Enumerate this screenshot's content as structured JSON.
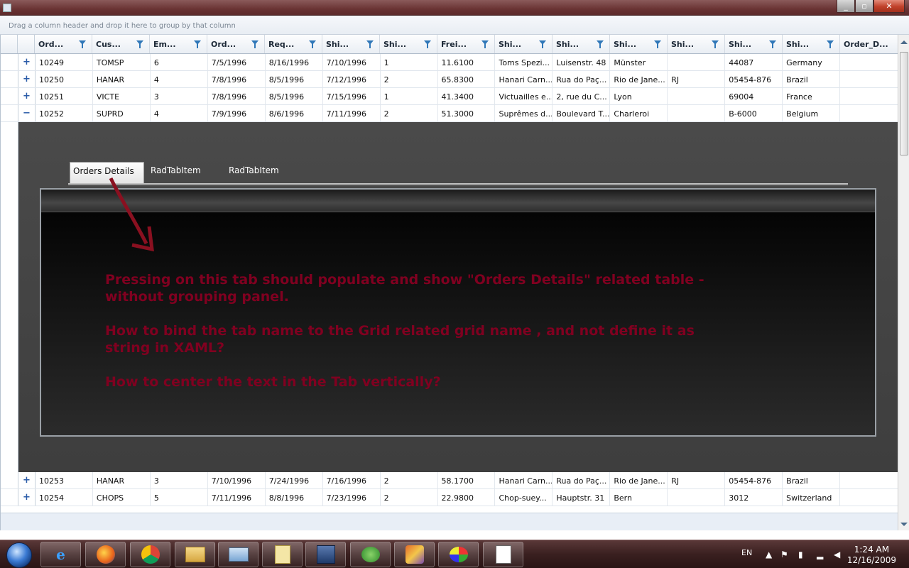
{
  "group_panel": {
    "hint": "Drag a column header and drop it here to group by that column"
  },
  "columns": [
    "Ord...",
    "Cus...",
    "Em...",
    "Ord...",
    "Req...",
    "Shi...",
    "Shi...",
    "Frei...",
    "Shi...",
    "Shi...",
    "Shi...",
    "Shi...",
    "Shi...",
    "Shi...",
    "Order_D..."
  ],
  "rows_top": [
    {
      "toggle": "+",
      "cells": [
        "10249",
        "TOMSP",
        "6",
        "7/5/1996",
        "8/16/1996",
        "7/10/1996",
        "1",
        "11.6100",
        "Toms Spezi...",
        "Luisenstr. 48",
        "Münster",
        "",
        "44087",
        "Germany",
        ""
      ]
    },
    {
      "toggle": "+",
      "cells": [
        "10250",
        "HANAR",
        "4",
        "7/8/1996",
        "8/5/1996",
        "7/12/1996",
        "2",
        "65.8300",
        "Hanari Carn...",
        "Rua do Paç...",
        "Rio de Jane...",
        "RJ",
        "05454-876",
        "Brazil",
        ""
      ]
    },
    {
      "toggle": "+",
      "cells": [
        "10251",
        "VICTE",
        "3",
        "7/8/1996",
        "8/5/1996",
        "7/15/1996",
        "1",
        "41.3400",
        "Victuailles e...",
        "2, rue du C...",
        "Lyon",
        "",
        "69004",
        "France",
        ""
      ]
    },
    {
      "toggle": "−",
      "cells": [
        "10252",
        "SUPRD",
        "4",
        "7/9/1996",
        "8/6/1996",
        "7/11/1996",
        "2",
        "51.3000",
        "Suprêmes d...",
        "Boulevard T...",
        "Charleroi",
        "",
        "B-6000",
        "Belgium",
        ""
      ]
    }
  ],
  "rows_bottom": [
    {
      "toggle": "+",
      "cells": [
        "10253",
        "HANAR",
        "3",
        "7/10/1996",
        "7/24/1996",
        "7/16/1996",
        "2",
        "58.1700",
        "Hanari Carn...",
        "Rua do Paç...",
        "Rio de Jane...",
        "RJ",
        "05454-876",
        "Brazil",
        ""
      ]
    },
    {
      "toggle": "+",
      "cells": [
        "10254",
        "CHOPS",
        "5",
        "7/11/1996",
        "8/8/1996",
        "7/23/1996",
        "2",
        "22.9800",
        "Chop-suey...",
        "Hauptstr. 31",
        "Bern",
        "",
        "3012",
        "Switzerland",
        ""
      ]
    }
  ],
  "detail": {
    "tabs": [
      {
        "label": "Orders Details",
        "active": true
      },
      {
        "label": "RadTabItem",
        "active": false
      },
      {
        "label": "RadTabItem",
        "active": false
      }
    ],
    "notes": [
      "Pressing on this tab should populate and show \"Orders Details\" related table - without grouping panel.",
      "How to bind the tab name to the Grid related grid name , and not define it as string in XAML?",
      "How to center the text in the Tab vertically?"
    ]
  },
  "taskbar": {
    "language": "EN",
    "time": "1:24 AM",
    "date": "12/16/2009",
    "apps": [
      "internet-explorer-icon",
      "firefox-icon",
      "chrome-icon",
      "file-explorer-icon",
      "keyboard-app-icon",
      "notes-app-icon",
      "media-player-icon",
      "messenger-icon",
      "visual-studio-icon",
      "paint-icon",
      "document-app-icon"
    ]
  },
  "colors": {
    "note_text": "#800020",
    "accent": "#2f77b8"
  }
}
